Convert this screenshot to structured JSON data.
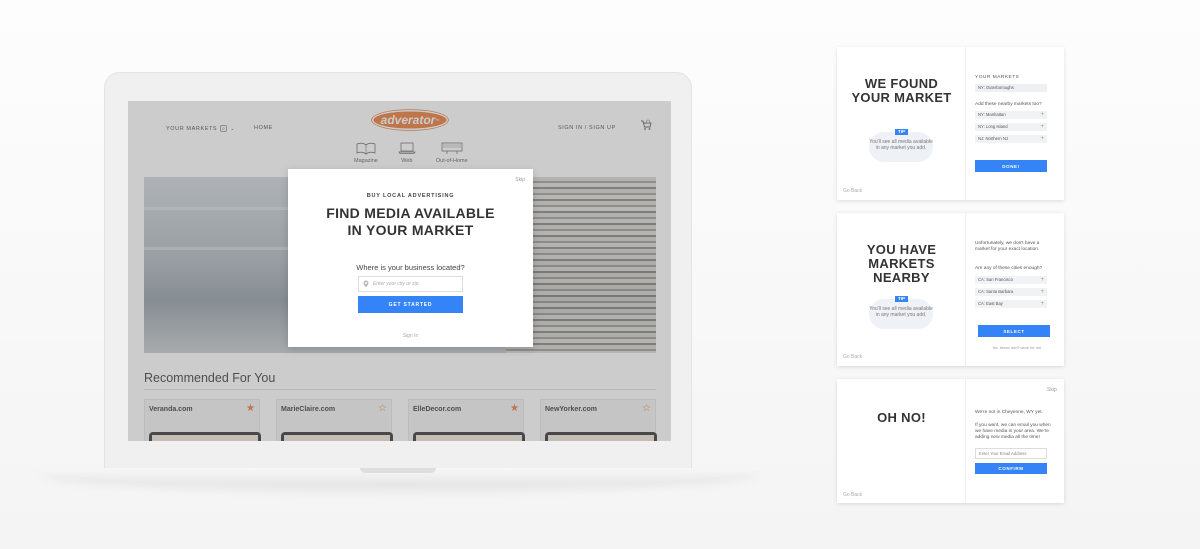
{
  "site": {
    "nav_markets": "YOUR MARKETS",
    "nav_markets_badge": "0",
    "nav_home": "HOME",
    "logo": "adverator",
    "logo_tm": "™",
    "nav_sign": "SIGN IN / SIGN UP",
    "categories": [
      "Magazine",
      "Web",
      "Out-of-Home"
    ],
    "recommended_title": "Recommended For You",
    "cards": [
      {
        "name": "Veranda.com",
        "starred": true
      },
      {
        "name": "MarieClaire.com",
        "starred": false
      },
      {
        "name": "ElleDecor.com",
        "starred": true
      },
      {
        "name": "NewYorker.com",
        "starred": false
      }
    ]
  },
  "modal": {
    "skip": "Skip",
    "eyebrow": "BUY LOCAL ADVERTISING",
    "title_line1": "FIND MEDIA AVAILABLE",
    "title_line2": "IN YOUR MARKET",
    "question": "Where is your business located?",
    "input_placeholder": "Enter your city or zip",
    "cta": "GET STARTED",
    "signin": "Sign In"
  },
  "panel_found": {
    "heading_line1": "WE FOUND",
    "heading_line2": "YOUR MARKET",
    "tip_label": "TIP",
    "tip_text": "You'll see all media available in any market you add.",
    "go_back": "Go Back",
    "your_markets_label": "YOUR MARKETS",
    "selected_market": "NY: Outerboroughs",
    "add_prompt": "Add these nearby markets too?",
    "nearby": [
      "NY: Manhattan",
      "NY: Long Island",
      "NJ: Northern NJ"
    ],
    "done": "DONE!"
  },
  "panel_nearby": {
    "heading_line1": "YOU HAVE",
    "heading_line2": "MARKETS",
    "heading_line3": "NEARBY",
    "tip_label": "TIP",
    "tip_text": "You'll see all media available in any market you add.",
    "go_back": "Go Back",
    "intro": "Unfortunately, we don't have a market for your exact location.",
    "question": "Are any of these cities enough?",
    "cities": [
      "CA: San Francisco",
      "CA: Santa Barbara",
      "CA: East Bay"
    ],
    "select": "SELECT",
    "decline": "No, these don't work for me"
  },
  "panel_ohno": {
    "skip": "Skip",
    "heading": "OH NO!",
    "go_back": "Go Back",
    "line1": "We're not in Cheyenne, WY yet.",
    "line2": "If you want, we can email you when we have media in your area. We're adding new media all the time!",
    "email_placeholder": "Enter Your Email Address",
    "confirm": "CONFIRM"
  },
  "colors": {
    "accent": "#3584f7",
    "brand": "#e8732d"
  }
}
